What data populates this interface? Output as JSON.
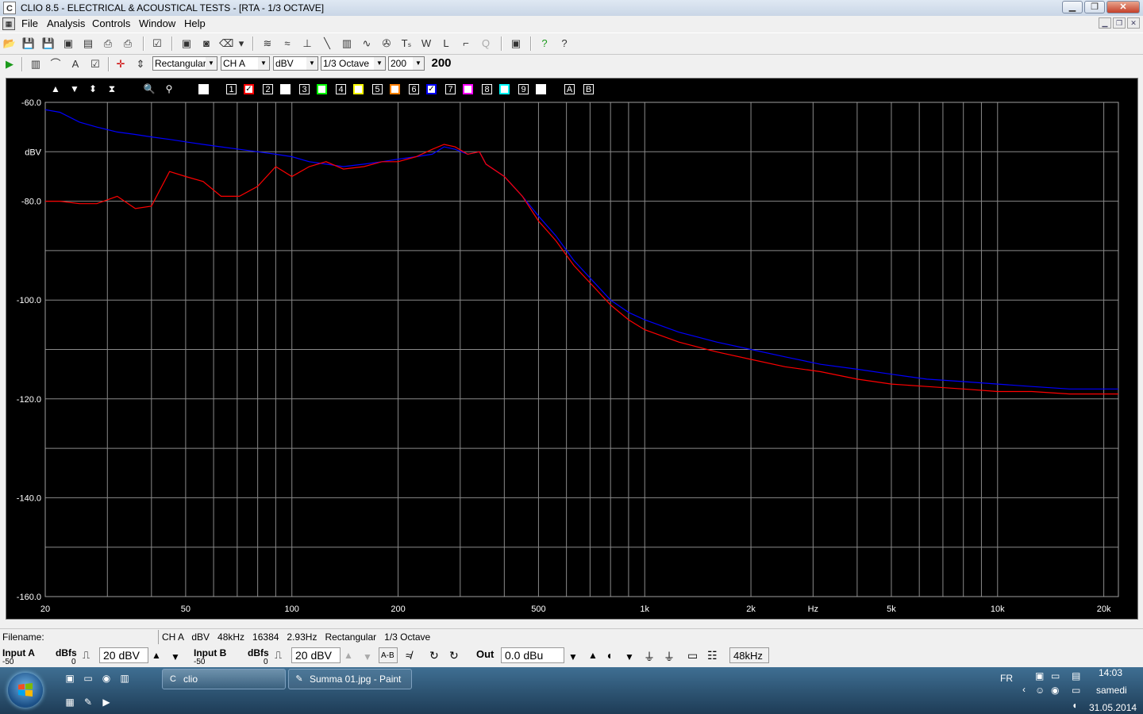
{
  "window": {
    "title": "CLIO 8.5 - ELECTRICAL & ACOUSTICAL TESTS - [RTA - 1/3 OCTAVE]",
    "app_icon": "C"
  },
  "menu": [
    "File",
    "Analysis",
    "Controls",
    "Window",
    "Help"
  ],
  "toolbar2": {
    "window_type": "Rectangular",
    "channel": "CH A",
    "unit": "dBV",
    "band": "1/3 Octave",
    "averages": "200",
    "averages_display": "200"
  },
  "overlay": {
    "slots": [
      "1",
      "2",
      "3",
      "4",
      "5",
      "6",
      "7",
      "8",
      "9"
    ],
    "slot_colors": [
      "#ff0000",
      "#ffffff",
      "#00ff00",
      "#ffff00",
      "#ff8000",
      "#0000ff",
      "#ff00ff",
      "#00ffff",
      "#ffffff"
    ],
    "slot_checked": [
      true,
      false,
      false,
      false,
      false,
      true,
      false,
      false,
      false
    ],
    "ab": [
      "A",
      "B"
    ]
  },
  "chart_data": {
    "type": "line",
    "xscale": "log",
    "xlim": [
      20,
      22000
    ],
    "ylim": [
      -160,
      -60
    ],
    "yticks": [
      {
        "value": -60,
        "label": "-60.0"
      },
      {
        "value": -70,
        "label": "dBV"
      },
      {
        "value": -80,
        "label": "-80.0"
      },
      {
        "value": -100,
        "label": "-100.0"
      },
      {
        "value": -120,
        "label": "-120.0"
      },
      {
        "value": -140,
        "label": "-140.0"
      },
      {
        "value": -160,
        "label": "-160.0"
      }
    ],
    "xticks": [
      {
        "value": 20,
        "label": "20"
      },
      {
        "value": 50,
        "label": "50"
      },
      {
        "value": 100,
        "label": "100"
      },
      {
        "value": 200,
        "label": "200"
      },
      {
        "value": 500,
        "label": "500"
      },
      {
        "value": 1000,
        "label": "1k"
      },
      {
        "value": 2000,
        "label": "2k"
      },
      {
        "value": 3000,
        "label": "Hz"
      },
      {
        "value": 5000,
        "label": "5k"
      },
      {
        "value": 10000,
        "label": "10k"
      },
      {
        "value": 20000,
        "label": "20k"
      }
    ],
    "grid": true,
    "series": [
      {
        "color": "#0000ff",
        "x": [
          20,
          22,
          25,
          28,
          32,
          36,
          40,
          45,
          50,
          56,
          63,
          71,
          80,
          90,
          100,
          112,
          125,
          140,
          160,
          180,
          200,
          225,
          250,
          270,
          290,
          315,
          340,
          355,
          400,
          450,
          500,
          560,
          630,
          710,
          800,
          900,
          1000,
          1250,
          1600,
          2000,
          2500,
          3150,
          4000,
          5000,
          6300,
          8000,
          10000,
          12500,
          16000,
          20000,
          22000
        ],
        "y": [
          -61.5,
          -62,
          -64,
          -65,
          -66,
          -66.5,
          -67,
          -67.5,
          -68,
          -68.5,
          -69,
          -69.5,
          -70,
          -70.5,
          -71,
          -72,
          -72.5,
          -73,
          -72.5,
          -72,
          -71.5,
          -71,
          -70.5,
          -69,
          -69.5,
          -70.5,
          -70,
          -72.5,
          -75,
          -79,
          -83,
          -87,
          -92,
          -96,
          -100,
          -102.5,
          -104,
          -106.5,
          -108.5,
          -110,
          -111.5,
          -113,
          -114,
          -115,
          -116,
          -116.5,
          -117,
          -117.5,
          -118,
          -118,
          -118
        ]
      },
      {
        "color": "#ff0000",
        "x": [
          20,
          22,
          25,
          28,
          32,
          36,
          40,
          45,
          50,
          56,
          63,
          71,
          80,
          90,
          100,
          112,
          125,
          140,
          160,
          180,
          200,
          225,
          250,
          270,
          290,
          315,
          340,
          355,
          400,
          450,
          500,
          560,
          630,
          710,
          800,
          900,
          1000,
          1250,
          1600,
          2000,
          2500,
          3150,
          4000,
          5000,
          6300,
          8000,
          10000,
          12500,
          16000,
          20000,
          22000
        ],
        "y": [
          -80,
          -80,
          -80.5,
          -80.5,
          -79,
          -81.5,
          -81,
          -74,
          -75,
          -76,
          -79,
          -79,
          -77,
          -73,
          -75,
          -73,
          -72,
          -73.5,
          -73,
          -72,
          -72,
          -71,
          -69.5,
          -68.5,
          -69,
          -70.5,
          -70,
          -72.5,
          -75,
          -79,
          -84,
          -88,
          -93,
          -97,
          -101,
          -104,
          -106,
          -108.5,
          -110.5,
          -112,
          -113.5,
          -114.5,
          -116,
          -117,
          -117.5,
          -118,
          -118.5,
          -118.5,
          -119,
          -119,
          -119
        ]
      }
    ]
  },
  "status": {
    "filename_label": "Filename:",
    "info": "CH A   dBV   48kHz   16384   2.93Hz   Rectangular   1/3 Octave"
  },
  "inputs": {
    "input_a_label": "Input A",
    "input_a_unit": "dBfs",
    "input_a_sub": "-50",
    "input_a_sub2": "0",
    "input_a_range": "20 dBV",
    "input_b_label": "Input B",
    "input_b_unit": "dBfs",
    "input_b_sub": "-50",
    "input_b_sub2": "0",
    "input_b_range": "20 dBV",
    "ab_label": "A-B",
    "out_label": "Out",
    "out_value": "0.0 dBu",
    "sample_rate": "48kHz"
  },
  "taskbar": {
    "tasks": [
      "clio",
      "Summa 01.jpg - Paint"
    ],
    "lang": "FR",
    "time": "14:03",
    "day": "samedi",
    "date": "31.05.2014"
  }
}
